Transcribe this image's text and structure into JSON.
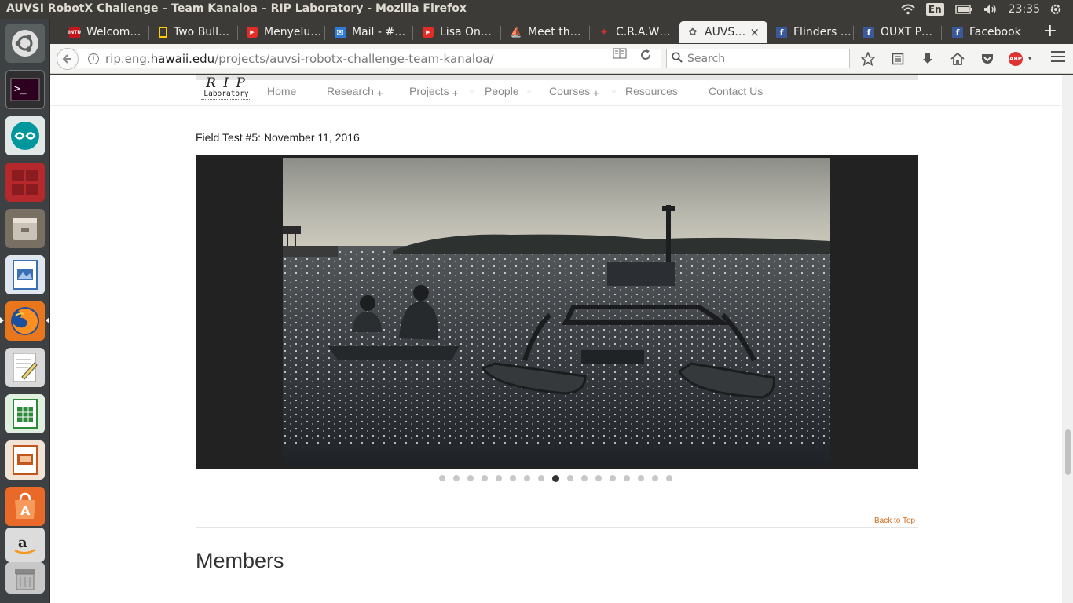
{
  "window": {
    "title": "AUVSI RobotX Challenge – Team Kanaloa – RIP Laboratory - Mozilla Firefox"
  },
  "tray": {
    "language": "En",
    "clock": "23:35"
  },
  "launcher": {
    "icons": [
      "ubuntu-dash-icon",
      "terminal-icon",
      "arduino-icon",
      "workspace-switcher-icon",
      "files-icon",
      "libreoffice-draw-icon",
      "firefox-icon",
      "text-editor-icon",
      "libreoffice-calc-icon",
      "libreoffice-impress-icon",
      "software-center-icon",
      "amazon-icon",
      "trash-icon"
    ]
  },
  "tabs": [
    {
      "label": "Welcom…",
      "icon": "intu-favicon",
      "icon_text": "INTU",
      "icon_color": "#c4161c",
      "active": false
    },
    {
      "label": "Two Bull…",
      "icon": "natgeo-favicon",
      "icon_text": "",
      "icon_color": "#ffce00",
      "active": false
    },
    {
      "label": "Menyelu…",
      "icon": "youtube-favicon",
      "icon_text": "▶",
      "icon_color": "#e52d27",
      "active": false
    },
    {
      "label": "Mail - #…",
      "icon": "mail-favicon",
      "icon_text": "✉",
      "icon_color": "#2f7bd6",
      "active": false
    },
    {
      "label": "Lisa On…",
      "icon": "youtube-favicon",
      "icon_text": "▶",
      "icon_color": "#e52d27",
      "active": false
    },
    {
      "label": "Meet th…",
      "icon": "boat-favicon",
      "icon_text": "⛵",
      "icon_color": "#2b5f8a",
      "active": false
    },
    {
      "label": "C.R.A.W…",
      "icon": "craw-favicon",
      "icon_text": "✦",
      "icon_color": "#b02020",
      "active": false
    },
    {
      "label": "AUVS…",
      "icon": "rip-favicon",
      "icon_text": "✿",
      "icon_color": "#666666",
      "active": true
    },
    {
      "label": "Flinders …",
      "icon": "facebook-favicon",
      "icon_text": "f",
      "icon_color": "#3b5998",
      "active": false
    },
    {
      "label": "OUXT P…",
      "icon": "facebook-favicon",
      "icon_text": "f",
      "icon_color": "#3b5998",
      "active": false
    },
    {
      "label": "Facebook",
      "icon": "facebook-favicon",
      "icon_text": "f",
      "icon_color": "#3b5998",
      "active": false
    }
  ],
  "tab_close": "×",
  "new_tab": "+",
  "urlbar": {
    "scheme_prefix": "rip.eng.",
    "host": "hawaii.edu",
    "path": "/projects/auvsi-robotx-challenge-team-kanaloa/"
  },
  "search": {
    "placeholder": "Search"
  },
  "site": {
    "logo_title": "R I P",
    "logo_sub": "Laboratory",
    "nav": [
      {
        "label": "Home",
        "has_sub": false
      },
      {
        "label": "Research",
        "has_sub": true
      },
      {
        "label": "Projects",
        "has_sub": true
      },
      {
        "label": "People",
        "has_sub": false
      },
      {
        "label": "Courses",
        "has_sub": true
      },
      {
        "label": "Resources",
        "has_sub": false
      },
      {
        "label": "Contact Us",
        "has_sub": false
      }
    ],
    "submenu_marker": "+",
    "caption": "Field Test #5: November 11, 2016",
    "slider": {
      "total": 17,
      "current": 9
    },
    "back_to_top": "Back to Top",
    "section_heading": "Members"
  }
}
